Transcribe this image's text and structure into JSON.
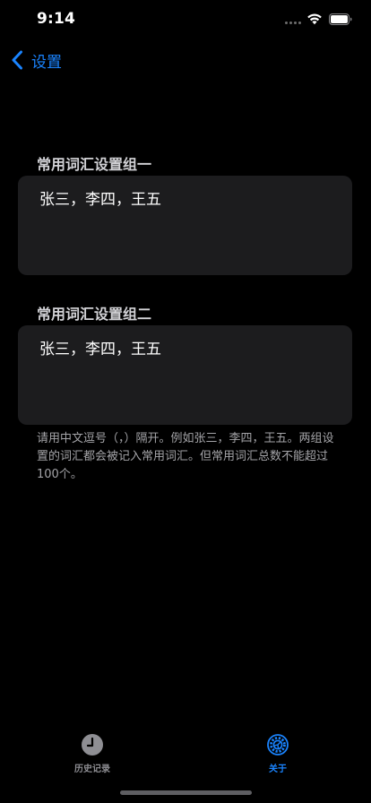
{
  "status_bar": {
    "time": "9:14"
  },
  "nav": {
    "back_label": "设置"
  },
  "groups": [
    {
      "header": "常用词汇设置组一",
      "value": "张三，李四，王五"
    },
    {
      "header": "常用词汇设置组二",
      "value": "张三，李四，王五"
    }
  ],
  "footer_note": "请用中文逗号（，）隔开。例如张三，李四，王五。两组设置的词汇都会被记入常用词汇。但常用词汇总数不能超过100个。",
  "tab_bar": {
    "tabs": [
      {
        "label": "历史记录",
        "icon": "clock-icon",
        "selected": false
      },
      {
        "label": "关于",
        "icon": "gear-icon",
        "selected": true
      }
    ]
  },
  "colors": {
    "accent": "#1a84ff",
    "background": "#000000",
    "field_background": "#1c1c1e",
    "inactive_tab": "#8e8e93"
  }
}
